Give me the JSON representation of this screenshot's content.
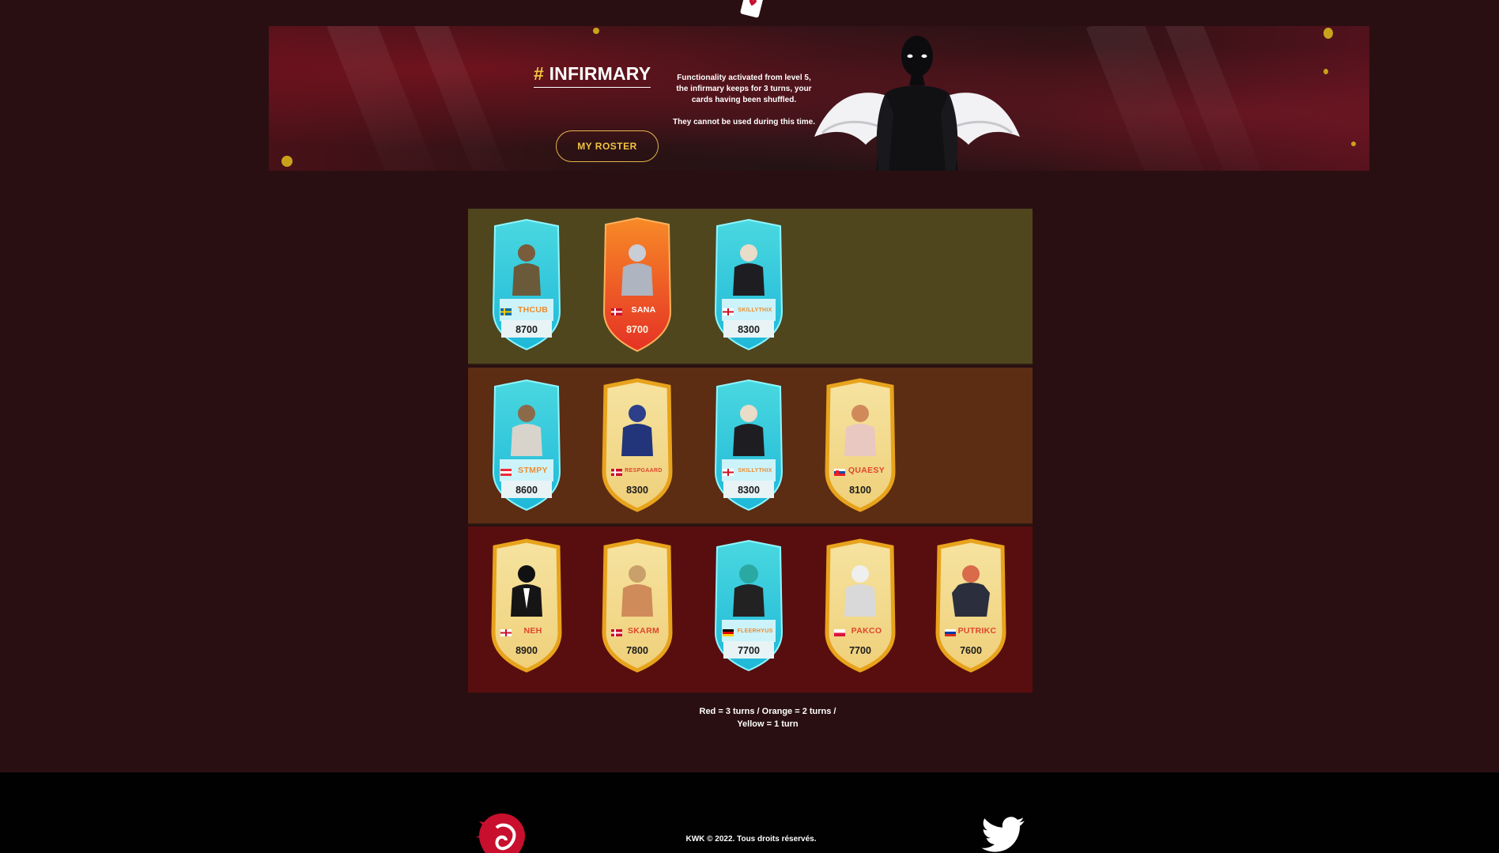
{
  "banner": {
    "hash": "#",
    "title": "INFIRMARY",
    "description_1": "Functionality activated from level 5, the infirmary keeps for 3 turns, your cards having been shuffled.",
    "description_2": "They cannot be used during this time.",
    "roster_button": "MY ROSTER"
  },
  "tiers": [
    {
      "color": "#4f461e",
      "cards": [
        {
          "name": "THCUB",
          "score": "8700",
          "style": "cyan",
          "flag": "se"
        },
        {
          "name": "SANA",
          "score": "8700",
          "style": "orange",
          "flag": "dk"
        },
        {
          "name": "SKILLYTHIX",
          "score": "8300",
          "style": "cyan",
          "flag": "en"
        }
      ]
    },
    {
      "color": "#5c2c13",
      "cards": [
        {
          "name": "STMPY",
          "score": "8600",
          "style": "cyan",
          "flag": "at"
        },
        {
          "name": "RESPGAARD",
          "score": "8300",
          "style": "gold",
          "flag": "dk"
        },
        {
          "name": "SKILLYTHIX",
          "score": "8300",
          "style": "cyan",
          "flag": "en"
        },
        {
          "name": "QUAESY",
          "score": "8100",
          "style": "gold",
          "flag": "sk"
        }
      ]
    },
    {
      "color": "#580e0e",
      "cards": [
        {
          "name": "NEH",
          "score": "8900",
          "style": "gold",
          "flag": "en"
        },
        {
          "name": "SKARM",
          "score": "7800",
          "style": "gold",
          "flag": "dk"
        },
        {
          "name": "FLEERHYUS",
          "score": "7700",
          "style": "cyan",
          "flag": "de"
        },
        {
          "name": "PAKCO",
          "score": "7700",
          "style": "gold",
          "flag": "pl"
        },
        {
          "name": "PUTRIKC",
          "score": "7600",
          "style": "gold",
          "flag": "ru"
        }
      ]
    }
  ],
  "legend": {
    "line1": "Red = 3 turns / Orange = 2 turns /",
    "line2": "Yellow = 1 turn"
  },
  "footer": {
    "copyright": "KWK © 2022. Tous droits réservés."
  }
}
